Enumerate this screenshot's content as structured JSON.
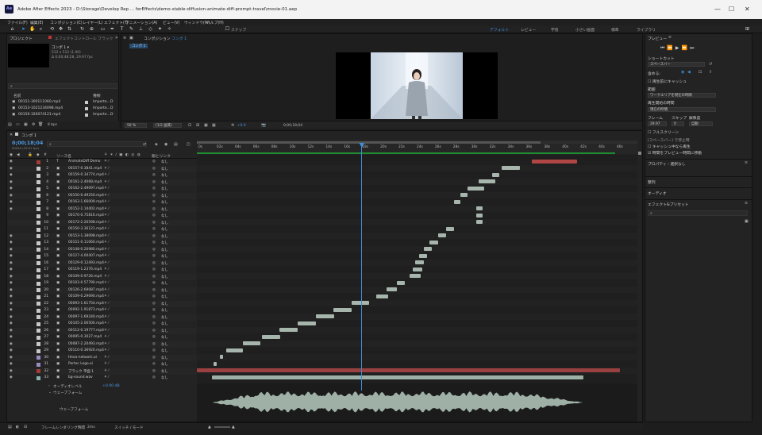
{
  "window": {
    "app_icon": "Ae",
    "title": "Adobe After Effects 2023 - D:\\Storage\\Develop Rep ... ferEffects\\demo-stable-diffusion-animate-diff-prompt-travel\\movie-01.aep"
  },
  "menu": [
    "ファイル(F)",
    "編集(E)",
    "コンポジション(C)",
    "レイヤー(L)",
    "エフェクト(T)",
    "アニメーション(A)",
    "ビュー(V)",
    "ウィンドウ(W)",
    "ヘルプ(H)"
  ],
  "toolbar": {
    "snap_label": "スナップ",
    "workspaces": [
      "デフォルト",
      "レビュー",
      "学習",
      "小さい画面",
      "標準",
      "ライブラリ"
    ]
  },
  "project": {
    "tab_label": "プロジェクト",
    "effects_tab_label": "エフェクトコントロール ブラック",
    "comp_name": "コンポ 1 ▾",
    "comp_info": "512 x 512 (1.00)",
    "comp_duration": "Δ 0;00;48;28, 29.97 fps",
    "col_name": "名前",
    "col_type": "種類",
    "items": [
      {
        "name": "00151-300111060.mp4",
        "type": "Importe...D"
      },
      {
        "name": "00153-1021234098.mp4",
        "type": "Importe...D"
      },
      {
        "name": "00156-326074121.mp4",
        "type": "Importe...D"
      }
    ],
    "bpc": "8 bpc"
  },
  "composition_panel": {
    "tab_label": "コンポジション",
    "tab_name": "コンポ 1",
    "breadcrumb": "コンポ 1",
    "zoom": "50 %",
    "resolution": "(1/2 画質)",
    "exposure": "+0.0",
    "timecode": "0;00;18;04"
  },
  "timeline": {
    "tab_name": "コンポ 1",
    "current_time": "0;00;18;04",
    "current_frames": "00544 (29.97 fps)",
    "col_source": "ソース名",
    "col_parent": "親とリンク",
    "ruler_labels": [
      "0s",
      "02s",
      "04s",
      "06s",
      "08s",
      "10s",
      "12s",
      "14s",
      "16s",
      "18s",
      "20s",
      "22s",
      "24s",
      "26s",
      "28s",
      "30s",
      "32s",
      "34s",
      "36s",
      "38s",
      "40s",
      "42s",
      "44s",
      "46s"
    ],
    "playhead_sec": 18.1,
    "duration_sec": 48.9,
    "layers": [
      {
        "num": "1",
        "name": "AnimateDiff Demo",
        "color": "#a33a3a",
        "parent": "なし",
        "in": 36.8,
        "out": 41.8,
        "bar_color": "#b04545",
        "icon": "T"
      },
      {
        "num": "2",
        "name": "00157-0.3841.mp4",
        "color": "#c8c8c8",
        "parent": "なし",
        "in": 33.5,
        "out": 35.5
      },
      {
        "num": "3",
        "name": "00159-0.34774.mp4",
        "color": "#c8c8c8",
        "parent": "なし",
        "in": 32.5,
        "out": 33.3
      },
      {
        "num": "4",
        "name": "00161-2.4068.mp4",
        "color": "#c8c8c8",
        "parent": "なし",
        "in": 31.0,
        "out": 32.8
      },
      {
        "num": "5",
        "name": "00162-2.49097.mp4",
        "color": "#c8c8c8",
        "parent": "なし",
        "in": 29.8,
        "out": 31.6
      },
      {
        "num": "6",
        "name": "00150-0.49250.mp4",
        "color": "#c8c8c8",
        "parent": "なし",
        "in": 29.0,
        "out": 29.8
      },
      {
        "num": "7",
        "name": "00163-1.66009.mp4",
        "color": "#c8c8c8",
        "parent": "なし",
        "in": 28.3,
        "out": 29.0
      },
      {
        "num": "8",
        "name": "00152-1.14402.mp4",
        "color": "#c8c8c8",
        "parent": "なし",
        "in": 30.7,
        "out": 31.4
      },
      {
        "num": "9",
        "name": "00170-0.75816.mp4",
        "color": "#c8c8c8",
        "parent": "なし",
        "in": 30.7,
        "out": 31.4
      },
      {
        "num": "10",
        "name": "00172-2.20598.mp4",
        "color": "#c8c8c8",
        "parent": "なし",
        "in": 30.7,
        "out": 31.4
      },
      {
        "num": "11",
        "name": "00150-3.36121.mp4",
        "color": "#c8c8c8",
        "parent": "なし",
        "in": 27.4,
        "out": 28.3
      },
      {
        "num": "12",
        "name": "00153-1.38098.mp4",
        "color": "#c8c8c8",
        "parent": "なし",
        "in": 26.5,
        "out": 27.4
      },
      {
        "num": "13",
        "name": "00151-0.11060.mp4",
        "color": "#c8c8c8",
        "parent": "なし",
        "in": 25.6,
        "out": 26.5
      },
      {
        "num": "14",
        "name": "00148-0.20980.mp4",
        "color": "#c8c8c8",
        "parent": "なし",
        "in": 25.0,
        "out": 25.8
      },
      {
        "num": "15",
        "name": "00127-4.00407.mp4",
        "color": "#c8c8c8",
        "parent": "なし",
        "in": 24.4,
        "out": 25.3
      },
      {
        "num": "16",
        "name": "00129-0.12493.mp4",
        "color": "#c8c8c8",
        "parent": "なし",
        "in": 24.0,
        "out": 25.0
      },
      {
        "num": "17",
        "name": "00119-1.2376.mp4",
        "color": "#c8c8c8",
        "parent": "なし",
        "in": 23.7,
        "out": 24.8
      },
      {
        "num": "18",
        "name": "00109-0.9726.mp4",
        "color": "#c8c8c8",
        "parent": "なし",
        "in": 23.4,
        "out": 24.6
      },
      {
        "num": "19",
        "name": "00103-0.57790.mp4",
        "color": "#c8c8c8",
        "parent": "なし",
        "in": 22.0,
        "out": 22.9
      },
      {
        "num": "20",
        "name": "00126-2.69087.mp4",
        "color": "#c8c8c8",
        "parent": "なし",
        "in": 20.9,
        "out": 22.0
      },
      {
        "num": "21",
        "name": "00109-0.29690.mp4",
        "color": "#c8c8c8",
        "parent": "なし",
        "in": 19.7,
        "out": 21.0
      },
      {
        "num": "22",
        "name": "00093-1.61754.mp4",
        "color": "#c8c8c8",
        "parent": "なし",
        "in": 17.0,
        "out": 18.9
      },
      {
        "num": "23",
        "name": "00092-1.91873.mp4",
        "color": "#c8c8c8",
        "parent": "なし",
        "in": 15.0,
        "out": 17.0
      },
      {
        "num": "24",
        "name": "00097-1.69240.mp4",
        "color": "#c8c8c8",
        "parent": "なし",
        "in": 13.1,
        "out": 15.1
      },
      {
        "num": "25",
        "name": "00105-2.00500.mp4",
        "color": "#c8c8c8",
        "parent": "なし",
        "in": 11.1,
        "out": 13.1
      },
      {
        "num": "26",
        "name": "00112-0.19777.mp4",
        "color": "#c8c8c8",
        "parent": "なし",
        "in": 9.1,
        "out": 11.1
      },
      {
        "num": "27",
        "name": "00095-0.3027.mp4",
        "color": "#c8c8c8",
        "parent": "なし",
        "in": 7.2,
        "out": 9.2
      },
      {
        "num": "28",
        "name": "00087-2.20493.mp4",
        "color": "#c8c8c8",
        "parent": "なし",
        "in": 5.1,
        "out": 7.0
      },
      {
        "num": "29",
        "name": "00110-0.36920.mp4",
        "color": "#c8c8c8",
        "parent": "なし",
        "in": 3.2,
        "out": 5.1
      },
      {
        "num": "30",
        "name": "Hexa-network.ai",
        "color": "#9b8bc4",
        "parent": "なし",
        "in": 2.5,
        "out": 2.9,
        "icon": "ai"
      },
      {
        "num": "31",
        "name": "Portec Logo.ai",
        "color": "#9b8bc4",
        "parent": "なし",
        "in": 1.8,
        "out": 2.2,
        "icon": "ai"
      },
      {
        "num": "32",
        "name": "ブラック 平面 1",
        "color": "#a33a3a",
        "parent": "なし",
        "in": 0,
        "out": 46.5,
        "bar_color": "#9a4040"
      },
      {
        "num": "33",
        "name": "bg-sound.wav",
        "color": "#8ab0b0",
        "parent": "なし",
        "in": 1.7,
        "out": 42.5
      }
    ],
    "audio_level_label": "オーディオレベル",
    "audio_level_value": "+0.00 dB",
    "waveform_label": "ウェーブフォーム",
    "waveform_track_label": "ウェーブフォーム"
  },
  "preview": {
    "title": "プレビュー",
    "shortcut_label": "ショートカット",
    "shortcut_value": "スペースバー",
    "include_label": "含める:",
    "cache_before": "再生前にキャッシュ",
    "range_label": "範囲",
    "range_value": "ワークエリアを現在の時間",
    "play_from_label": "再生開始の時間",
    "play_from_value": "現在の時間",
    "frame_label": "フレーム",
    "skip_label": "スキップ",
    "res_label": "解像度",
    "frame_rate": "29.97",
    "skip": "0",
    "resolution": "自動",
    "fullscreen": "フルスクリーン",
    "on_stop_label": "(スペースバー) で停止時",
    "cache_stop": "キャッシュ中なら再生",
    "move_time": "時間をプレビュー時間に移動",
    "properties": "プロパティ : 選択なし",
    "align": "整列",
    "audio": "オーディオ",
    "effects_presets": "エフェクト&プリセット"
  },
  "status": {
    "render_time_label": "フレームレンダリング時間",
    "render_time": "2ms",
    "switch_mode": "スイッチ / モード"
  }
}
